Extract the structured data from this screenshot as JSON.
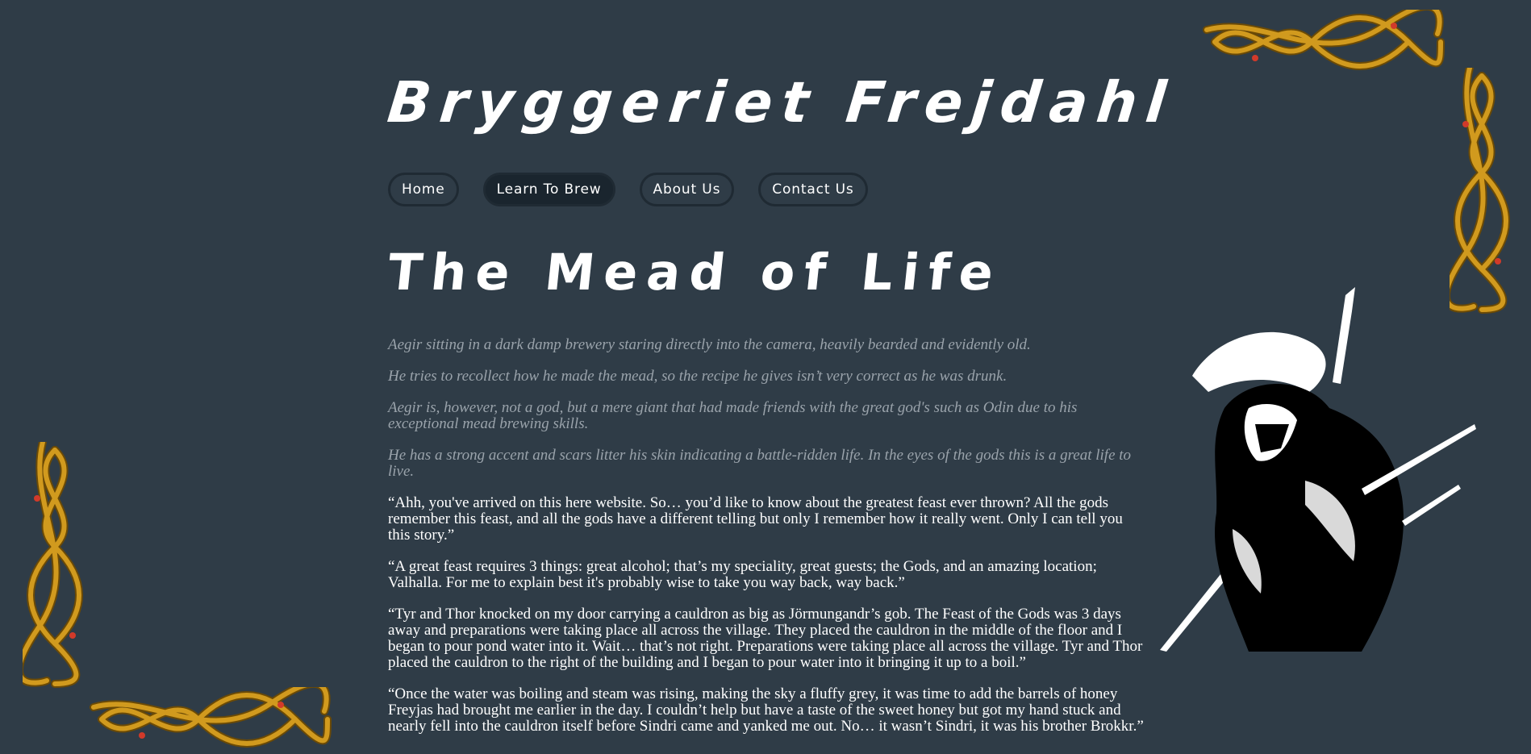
{
  "header": {
    "title": "Bryggeriet Frejdahl"
  },
  "nav": {
    "items": [
      {
        "label": "Home",
        "active": false
      },
      {
        "label": "Learn To Brew",
        "active": true
      },
      {
        "label": "About Us",
        "active": false
      },
      {
        "label": "Contact Us",
        "active": false
      }
    ]
  },
  "main": {
    "heading": "The Mead of Life",
    "directions": [
      "Aegir sitting in a dark damp brewery staring directly into the camera, heavily bearded and evidently old.",
      "He tries to recollect how he made the mead, so the recipe he gives isn’t very correct as he was drunk.",
      "Aegir is, however, not a god, but a mere giant that had made friends with the great god's such as Odin due to his exceptional mead brewing skills.",
      "He has a strong accent and scars litter his skin indicating a battle-ridden life. In the eyes of the gods this is a great life to live."
    ],
    "story": [
      "“Ahh, you've arrived on this here website. So… you’d like to know about the greatest feast ever thrown? All the gods remember this feast, and all the gods have a different telling but only I remember how it really went. Only I can tell you this story.”",
      "“A great feast requires 3 things: great alcohol; that’s my speciality, great guests; the Gods, and an amazing location; Valhalla. For me to explain best it's probably wise to take you way back, way back.”",
      "“Tyr and Thor knocked on my door carrying a cauldron as big as Jörmungandr’s gob. The Feast of the Gods was 3 days away and preparations were taking place all across the village. They placed the cauldron in the middle of the floor and I began to pour pond water into it. Wait… that’s not right. Preparations were taking place all across the village. Tyr and Thor placed the cauldron to the right of the building and I began to pour water into it bringing it up to a boil.”",
      "“Once the water was boiling and steam was rising, making the sky a fluffy grey, it was time to add the barrels of honey Freyjas had brought me earlier in the day. I couldn’t help but have a taste of the sweet honey but got my hand stuck and nearly fell into the cauldron itself before Sindri came and yanked me out. No… it wasn’t Sindri, it was his brother Brokkr.”"
    ]
  },
  "colors": {
    "background": "#2f3c47",
    "ornament": "#d19a1e",
    "ornament_dark": "#6b4a06",
    "eye": "#d23a2a"
  },
  "icons": [
    "celtic-knot-ornament",
    "viking-warrior-illustration"
  ]
}
